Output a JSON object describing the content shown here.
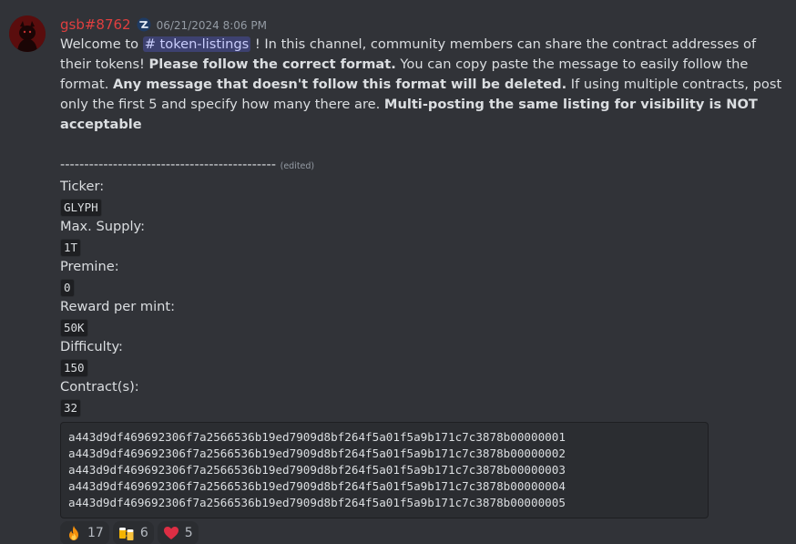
{
  "author": {
    "username": "gsb#8762",
    "timestamp": "06/21/2024 8:06 PM"
  },
  "message": {
    "p1_welcome": "Welcome to ",
    "p1_channel": "# token-listings",
    "p1_rest": " ! In this channel, community members can share the contract addresses of their tokens! ",
    "p1_bold1": "Please follow the correct format.",
    "p1_mid": " You can copy paste the message to easily follow the format. ",
    "p1_bold2": "Any message that doesn't follow this format will be deleted.",
    "p1_after": " If using multiple contracts, post only the first 5 and specify how many there are. ",
    "p1_bold3": "Multi-posting the same listing for visibility is NOT acceptable",
    "divider": "--------------------------------------------- ",
    "edited": "(edited)",
    "fields": [
      {
        "label": "Ticker:",
        "value": "GLYPH"
      },
      {
        "label": "Max. Supply:",
        "value": "1T"
      },
      {
        "label": "Premine:",
        "value": "0"
      },
      {
        "label": "Reward per mint:",
        "value": "50K"
      },
      {
        "label": "Difficulty:",
        "value": "150"
      },
      {
        "label": "Contract(s):",
        "value": "32"
      }
    ],
    "contracts": [
      "a443d9df469692306f7a2566536b19ed7909d8bf264f5a01f5a9b171c7c3878b00000001",
      "a443d9df469692306f7a2566536b19ed7909d8bf264f5a01f5a9b171c7c3878b00000002",
      "a443d9df469692306f7a2566536b19ed7909d8bf264f5a01f5a9b171c7c3878b00000003",
      "a443d9df469692306f7a2566536b19ed7909d8bf264f5a01f5a9b171c7c3878b00000004",
      "a443d9df469692306f7a2566536b19ed7909d8bf264f5a01f5a9b171c7c3878b00000005"
    ]
  },
  "reactions": [
    {
      "icon": "fire-icon",
      "count": "17"
    },
    {
      "icon": "beer-mugs-icon",
      "count": "6"
    },
    {
      "icon": "red-heart-icon",
      "count": "5"
    }
  ],
  "colors": {
    "background": "#313338",
    "username": "#e03f3f",
    "mention_bg": "#3c4270",
    "code_bg": "#2b2d31"
  }
}
